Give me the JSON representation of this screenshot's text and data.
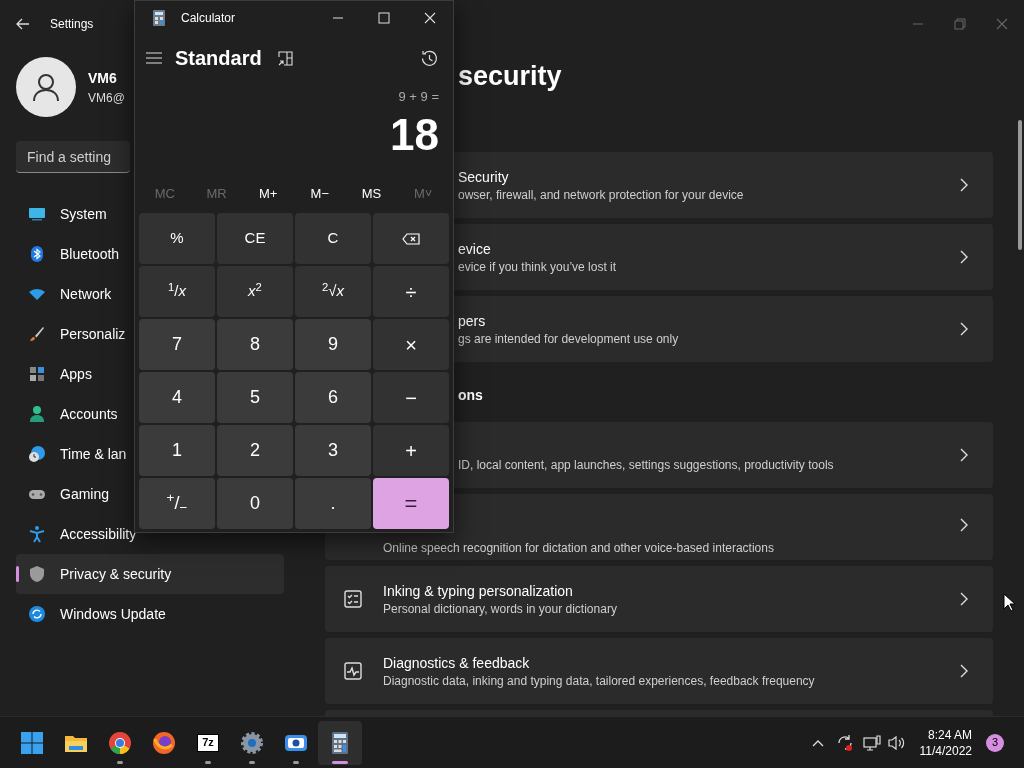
{
  "settings": {
    "title": "Settings",
    "profile": {
      "name": "VM6",
      "email": "VM6@"
    },
    "search": {
      "placeholder": "Find a setting"
    },
    "nav": [
      {
        "kind": "system",
        "label": "System",
        "selected": false
      },
      {
        "kind": "bluetooth",
        "label": "Bluetooth",
        "selected": false
      },
      {
        "kind": "network",
        "label": "Network",
        "selected": false
      },
      {
        "kind": "personalization",
        "label": "Personaliz",
        "selected": false
      },
      {
        "kind": "apps",
        "label": "Apps",
        "selected": false
      },
      {
        "kind": "accounts",
        "label": "Accounts",
        "selected": false
      },
      {
        "kind": "time",
        "label": "Time & lan",
        "selected": false
      },
      {
        "kind": "gaming",
        "label": "Gaming",
        "selected": false
      },
      {
        "kind": "accessibility",
        "label": "Accessibility",
        "selected": false
      },
      {
        "kind": "privacy",
        "label": "Privacy & security",
        "selected": true
      },
      {
        "kind": "update",
        "label": "Windows Update",
        "selected": false
      }
    ],
    "heading": "security",
    "content": [
      {
        "kind": "covered",
        "title": "Security",
        "description": "owser, firewall, and network protection for your device"
      },
      {
        "kind": "covered",
        "title": "evice",
        "description": "evice if you think you’ve lost it"
      },
      {
        "kind": "covered",
        "title": "pers",
        "description": "gs are intended for development use only"
      },
      {
        "kind": "section",
        "title": "ons"
      },
      {
        "kind": "covered",
        "description": "ID, local content, app launches, settings suggestions, productivity tools"
      },
      {
        "kind": "tail",
        "description": "Online speech recognition for dictation and other voice-based interactions"
      },
      {
        "kind": "checklist",
        "title": "Inking & typing personalization",
        "description": "Personal dictionary, words in your dictionary"
      },
      {
        "kind": "pulse",
        "title": "Diagnostics & feedback",
        "description": "Diagnostic data, inking and typing data, tailored experiences, feedback frequency"
      },
      {
        "kind": "cutoff"
      }
    ]
  },
  "calculator": {
    "title": "Calculator",
    "mode": "Standard",
    "expression": "9 + 9 =",
    "display": "18",
    "memory": [
      {
        "label": "MC",
        "disabled": true
      },
      {
        "label": "MR",
        "disabled": true
      },
      {
        "label": "M+",
        "disabled": false
      },
      {
        "label": "M−",
        "disabled": false
      },
      {
        "label": "MS",
        "disabled": false
      },
      {
        "label": "M˅",
        "disabled": true
      }
    ],
    "keys": [
      {
        "kind": "function",
        "label": "%"
      },
      {
        "kind": "function",
        "label": "CE"
      },
      {
        "kind": "function",
        "label": "C"
      },
      {
        "kind": "backspace"
      },
      {
        "kind": "function",
        "label": "$^{1}$/*x*"
      },
      {
        "kind": "function",
        "label": "*x*$^{2}$"
      },
      {
        "kind": "function",
        "label": "$^{2}$√*x*"
      },
      {
        "kind": "operator",
        "label": "÷"
      },
      {
        "kind": "digit",
        "label": "7"
      },
      {
        "kind": "digit",
        "label": "8"
      },
      {
        "kind": "digit",
        "label": "9"
      },
      {
        "kind": "operator",
        "label": "×"
      },
      {
        "kind": "digit",
        "label": "4"
      },
      {
        "kind": "digit",
        "label": "5"
      },
      {
        "kind": "digit",
        "label": "6"
      },
      {
        "kind": "operator",
        "label": "−"
      },
      {
        "kind": "digit",
        "label": "1"
      },
      {
        "kind": "digit",
        "label": "2"
      },
      {
        "kind": "digit",
        "label": "3"
      },
      {
        "kind": "operator",
        "label": "+"
      },
      {
        "kind": "digit",
        "label": "$^{+}$/$_{−}$"
      },
      {
        "kind": "digit",
        "label": "0"
      },
      {
        "kind": "digit",
        "label": "."
      },
      {
        "kind": "equals",
        "label": "="
      }
    ]
  },
  "taskbar": {
    "apps": [
      {
        "kind": "start",
        "running": false,
        "selected": false
      },
      {
        "kind": "folder",
        "running": false,
        "selected": false
      },
      {
        "kind": "chrome",
        "running": true,
        "selected": false
      },
      {
        "kind": "firefox",
        "running": false,
        "selected": false
      },
      {
        "kind": "archiver",
        "glyph": "7z",
        "running": true,
        "selected": false
      },
      {
        "kind": "gear",
        "running": true,
        "selected": false
      },
      {
        "kind": "camera",
        "running": true,
        "selected": false
      },
      {
        "kind": "calculator",
        "running": true,
        "selected": true
      }
    ],
    "time": "8:24 AM",
    "date": "11/4/2022",
    "notifications": "3"
  }
}
